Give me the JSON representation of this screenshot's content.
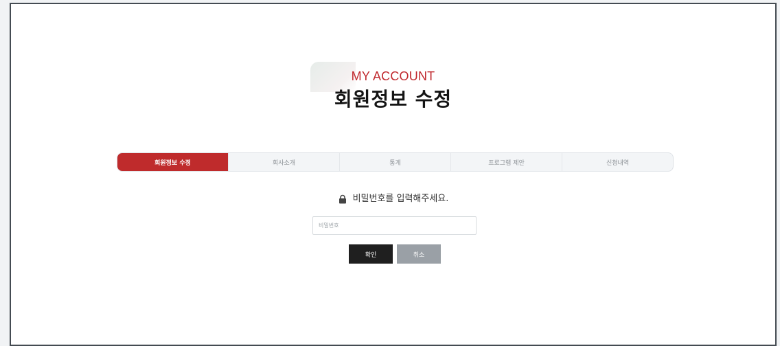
{
  "header": {
    "eyebrow": "MY ACCOUNT",
    "title": "회원정보 수정"
  },
  "tabs": [
    {
      "label": "회원정보 수정",
      "active": true
    },
    {
      "label": "회사소개",
      "active": false
    },
    {
      "label": "통계",
      "active": false
    },
    {
      "label": "프로그램 제안",
      "active": false
    },
    {
      "label": "신청내역",
      "active": false
    }
  ],
  "password_form": {
    "heading": "비밀번호를 입력해주세요.",
    "heading_icon": "lock-icon",
    "input_value": "",
    "input_placeholder": "비밀번호",
    "confirm_label": "확인",
    "cancel_label": "취소"
  },
  "colors": {
    "accent": "#bf2b2c",
    "eyebrow": "#c0282d",
    "confirm_button": "#1f1f1f",
    "cancel_button": "#9aa0a6"
  }
}
